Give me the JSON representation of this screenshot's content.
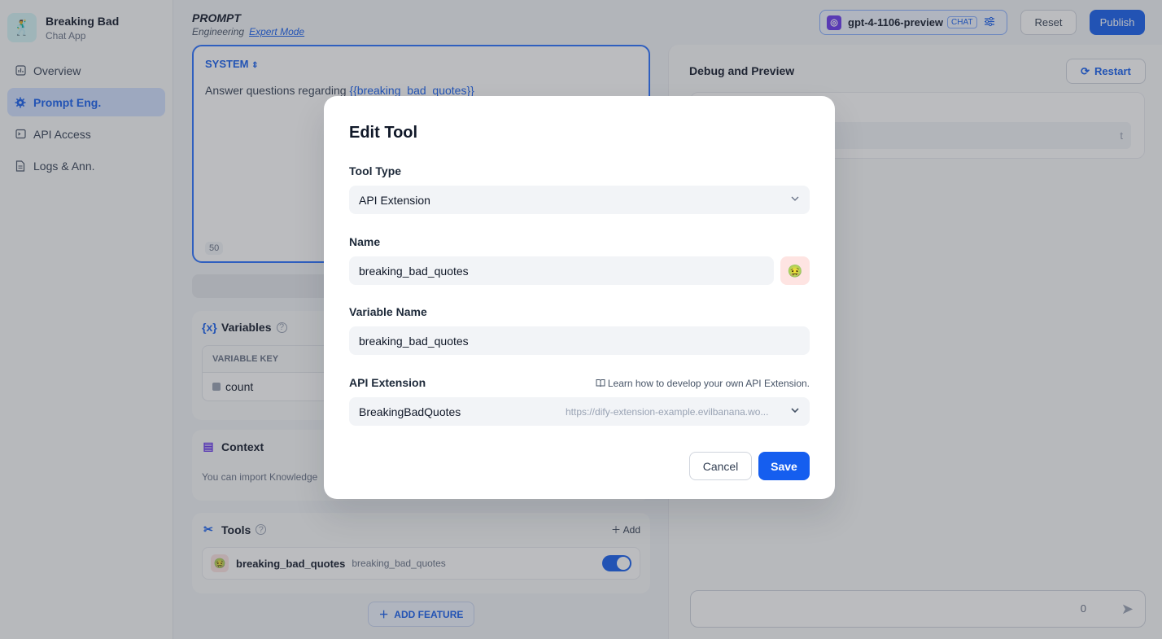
{
  "app": {
    "name": "Breaking Bad",
    "subtitle": "Chat App",
    "icon": "🕺"
  },
  "sidebar": {
    "items": [
      {
        "label": "Overview",
        "icon": "overview-icon"
      },
      {
        "label": "Prompt Eng.",
        "icon": "gear-icon",
        "active": true
      },
      {
        "label": "API Access",
        "icon": "terminal-icon"
      },
      {
        "label": "Logs & Ann.",
        "icon": "document-icon"
      }
    ]
  },
  "header": {
    "prompt_label": "PROMPT",
    "engineering_label": "Engineering",
    "expert_mode": "Expert Mode",
    "model": "gpt-4-1106-preview",
    "model_badge": "CHAT",
    "reset": "Reset",
    "publish": "Publish"
  },
  "system": {
    "label": "SYSTEM",
    "text_prefix": "Answer questions regarding ",
    "text_var": "{{breaking_bad_quotes}}",
    "count": "50"
  },
  "variables": {
    "title": "Variables",
    "column_key": "VARIABLE KEY",
    "rows": [
      "count"
    ]
  },
  "context": {
    "title": "Context",
    "text": "You can import Knowledge"
  },
  "tools": {
    "title": "Tools",
    "add": "Add",
    "items": [
      {
        "emoji": "🤢",
        "name": "breaking_bad_quotes",
        "variable": "breaking_bad_quotes",
        "enabled": true
      }
    ]
  },
  "add_feature": "ADD FEATURE",
  "debug": {
    "title": "Debug and Preview",
    "restart": "Restart",
    "input_placeholder_fragment": "t",
    "chat_count": "0"
  },
  "modal": {
    "title": "Edit Tool",
    "tool_type_label": "Tool Type",
    "tool_type_value": "API Extension",
    "name_label": "Name",
    "name_value": "breaking_bad_quotes",
    "name_emoji": "🤢",
    "variable_name_label": "Variable Name",
    "variable_name_value": "breaking_bad_quotes",
    "api_extension_label": "API Extension",
    "learn_link": "Learn how to develop your own API Extension.",
    "api_extension_value": "BreakingBadQuotes",
    "api_extension_url": "https://dify-extension-example.evilbanana.wo...",
    "cancel": "Cancel",
    "save": "Save"
  },
  "colors": {
    "primary": "#155eef",
    "overlay": "rgba(60,64,72,0.35)"
  }
}
